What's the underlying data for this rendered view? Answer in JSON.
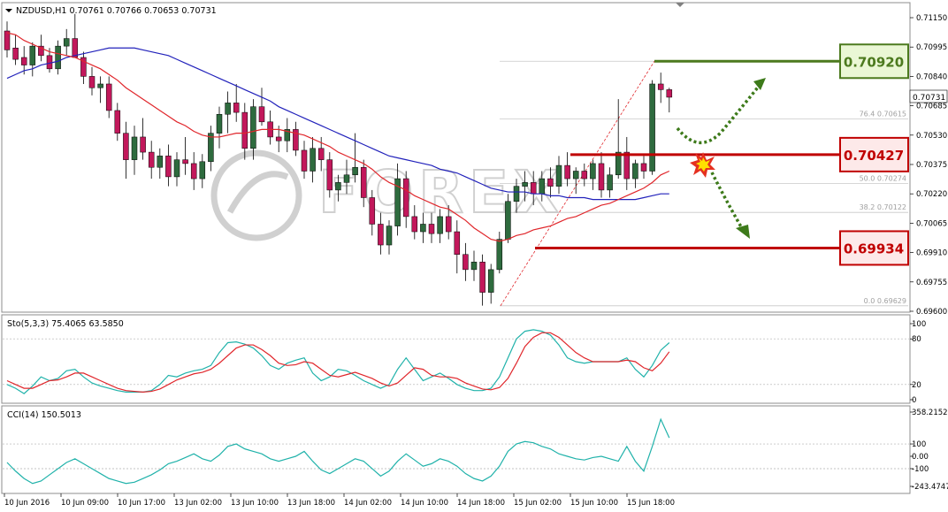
{
  "header": {
    "symbol_line": "NZDUSD,H1  0.70761 0.70766 0.70653 0.70731",
    "stoch_label": "Sto(5,3,3) 75.4065 63.5850",
    "cci_label": "CCI(14) 150.5013"
  },
  "watermark": "FOREX",
  "price_axis": {
    "ticks": [
      "0.71150",
      "0.70995",
      "0.70840",
      "0.70685",
      "0.70530",
      "0.70375",
      "0.70220",
      "0.70065",
      "0.69910",
      "0.69755",
      "0.69600"
    ],
    "current": "0.70731"
  },
  "stoch_axis": {
    "ticks": [
      "100",
      "80",
      "20",
      "0"
    ]
  },
  "cci_axis": {
    "ticks": [
      "358.2152",
      "100",
      "0.00",
      "-100",
      "-243.4747"
    ]
  },
  "time_axis": {
    "labels": [
      "10 Jun 2016",
      "10 Jun 09:00",
      "10 Jun 17:00",
      "13 Jun 02:00",
      "13 Jun 10:00",
      "13 Jun 18:00",
      "14 Jun 02:00",
      "14 Jun 10:00",
      "14 Jun 18:00",
      "15 Jun 02:00",
      "15 Jun 10:00",
      "15 Jun 18:00"
    ]
  },
  "fibonacci": {
    "levels": [
      {
        "label": "76.4  0.70615",
        "value": 0.70615
      },
      {
        "label": "50.0  0.70274",
        "value": 0.70274
      },
      {
        "label": "38.2  0.70122",
        "value": 0.70122
      },
      {
        "label": "0.0  0.69629",
        "value": 0.69629
      }
    ],
    "top_value": 0.7092
  },
  "levels": [
    {
      "label": "0.70920",
      "value": 0.7092,
      "color": "#4c7a1e",
      "bg": "#eaf7d5",
      "name": "resistance-level"
    },
    {
      "label": "0.70427",
      "value": 0.70427,
      "color": "#c00000",
      "bg": "#fde9e9",
      "name": "pivot-level"
    },
    {
      "label": "0.69934",
      "value": 0.69934,
      "color": "#c00000",
      "bg": "#fde9e9",
      "name": "support-level"
    }
  ],
  "colors": {
    "bull": "#2e6b3e",
    "bear": "#c2185b",
    "ma_fast": "#e0262b",
    "ma_slow": "#2222bb",
    "stoch_main": "#20b2aa",
    "stoch_signal": "#e0262b",
    "cci": "#20b2aa",
    "arrow": "#3d7a1a"
  },
  "chart_data": {
    "type": "candlestick",
    "symbol": "NZDUSD",
    "timeframe": "H1",
    "ylim": [
      0.696,
      0.712
    ],
    "candles": [
      [
        0.7108,
        0.7113,
        0.7094,
        0.7098
      ],
      [
        0.7099,
        0.7106,
        0.709,
        0.7093
      ],
      [
        0.7094,
        0.71,
        0.7085,
        0.709
      ],
      [
        0.709,
        0.7102,
        0.7084,
        0.71
      ],
      [
        0.71,
        0.7106,
        0.7092,
        0.7095
      ],
      [
        0.7095,
        0.7099,
        0.7086,
        0.7088
      ],
      [
        0.7088,
        0.7103,
        0.7085,
        0.71
      ],
      [
        0.71,
        0.7109,
        0.7095,
        0.7104
      ],
      [
        0.7104,
        0.7117,
        0.7098,
        0.7094
      ],
      [
        0.7094,
        0.7097,
        0.708,
        0.7084
      ],
      [
        0.7084,
        0.7089,
        0.7074,
        0.7078
      ],
      [
        0.7078,
        0.7084,
        0.707,
        0.708
      ],
      [
        0.708,
        0.7084,
        0.7062,
        0.7066
      ],
      [
        0.7066,
        0.707,
        0.705,
        0.7054
      ],
      [
        0.7054,
        0.706,
        0.703,
        0.704
      ],
      [
        0.704,
        0.7058,
        0.7032,
        0.7052
      ],
      [
        0.7052,
        0.7062,
        0.704,
        0.7044
      ],
      [
        0.7044,
        0.705,
        0.703,
        0.7036
      ],
      [
        0.7036,
        0.7046,
        0.703,
        0.7042
      ],
      [
        0.7042,
        0.7048,
        0.7026,
        0.7031
      ],
      [
        0.7031,
        0.7044,
        0.7026,
        0.704
      ],
      [
        0.704,
        0.7052,
        0.7032,
        0.7038
      ],
      [
        0.7038,
        0.7044,
        0.7024,
        0.703
      ],
      [
        0.703,
        0.7043,
        0.7025,
        0.7039
      ],
      [
        0.7039,
        0.7058,
        0.7034,
        0.7054
      ],
      [
        0.7054,
        0.7068,
        0.7046,
        0.7064
      ],
      [
        0.7064,
        0.7076,
        0.7054,
        0.707
      ],
      [
        0.707,
        0.708,
        0.706,
        0.7065
      ],
      [
        0.7065,
        0.707,
        0.704,
        0.7046
      ],
      [
        0.7046,
        0.7072,
        0.704,
        0.7068
      ],
      [
        0.7068,
        0.7078,
        0.7058,
        0.706
      ],
      [
        0.706,
        0.7066,
        0.7048,
        0.7052
      ],
      [
        0.7052,
        0.7058,
        0.7044,
        0.705
      ],
      [
        0.705,
        0.7062,
        0.7044,
        0.7056
      ],
      [
        0.7056,
        0.706,
        0.7042,
        0.7045
      ],
      [
        0.7045,
        0.705,
        0.703,
        0.7034
      ],
      [
        0.7034,
        0.7052,
        0.7028,
        0.7046
      ],
      [
        0.7046,
        0.7052,
        0.7034,
        0.704
      ],
      [
        0.704,
        0.7044,
        0.702,
        0.7024
      ],
      [
        0.7024,
        0.7032,
        0.7018,
        0.7028
      ],
      [
        0.7028,
        0.704,
        0.7022,
        0.7032
      ],
      [
        0.7032,
        0.7054,
        0.7028,
        0.7036
      ],
      [
        0.7036,
        0.704,
        0.7015,
        0.702
      ],
      [
        0.702,
        0.7024,
        0.7,
        0.7006
      ],
      [
        0.7006,
        0.7012,
        0.699,
        0.6995
      ],
      [
        0.6995,
        0.7008,
        0.699,
        0.7005
      ],
      [
        0.7005,
        0.7038,
        0.7,
        0.703
      ],
      [
        0.703,
        0.7034,
        0.7004,
        0.701
      ],
      [
        0.701,
        0.7016,
        0.6998,
        0.7002
      ],
      [
        0.7002,
        0.7012,
        0.6996,
        0.7006
      ],
      [
        0.7006,
        0.7012,
        0.6996,
        0.7001
      ],
      [
        0.7001,
        0.7014,
        0.6996,
        0.701
      ],
      [
        0.701,
        0.7016,
        0.6998,
        0.7002
      ],
      [
        0.7002,
        0.7008,
        0.698,
        0.699
      ],
      [
        0.699,
        0.6996,
        0.6976,
        0.6982
      ],
      [
        0.6982,
        0.6992,
        0.6976,
        0.6986
      ],
      [
        0.6986,
        0.699,
        0.6963,
        0.697
      ],
      [
        0.697,
        0.6985,
        0.6964,
        0.6982
      ],
      [
        0.6982,
        0.7002,
        0.698,
        0.6998
      ],
      [
        0.6998,
        0.7022,
        0.6996,
        0.7018
      ],
      [
        0.7018,
        0.703,
        0.7012,
        0.7026
      ],
      [
        0.7026,
        0.7034,
        0.7018,
        0.7028
      ],
      [
        0.7028,
        0.7034,
        0.7016,
        0.7022
      ],
      [
        0.7022,
        0.7034,
        0.7018,
        0.703
      ],
      [
        0.703,
        0.7036,
        0.702,
        0.7026
      ],
      [
        0.7026,
        0.7042,
        0.7022,
        0.7037
      ],
      [
        0.7037,
        0.7044,
        0.7026,
        0.703
      ],
      [
        0.703,
        0.7036,
        0.7022,
        0.7034
      ],
      [
        0.7034,
        0.7038,
        0.7026,
        0.703
      ],
      [
        0.703,
        0.704,
        0.7024,
        0.7038
      ],
      [
        0.7038,
        0.7044,
        0.702,
        0.7024
      ],
      [
        0.7024,
        0.7036,
        0.702,
        0.7032
      ],
      [
        0.7032,
        0.7072,
        0.703,
        0.7044
      ],
      [
        0.7044,
        0.7052,
        0.7024,
        0.703
      ],
      [
        0.703,
        0.704,
        0.7025,
        0.7038
      ],
      [
        0.7038,
        0.7042,
        0.703,
        0.7034
      ],
      [
        0.7034,
        0.7082,
        0.7032,
        0.708
      ],
      [
        0.708,
        0.7086,
        0.707,
        0.7077
      ],
      [
        0.7077,
        0.7078,
        0.7065,
        0.7073
      ]
    ],
    "ma_fast": [
      0.7107,
      0.7106,
      0.7103,
      0.7101,
      0.7099,
      0.7097,
      0.7096,
      0.7095,
      0.7094,
      0.7092,
      0.709,
      0.7088,
      0.7085,
      0.7082,
      0.7078,
      0.7075,
      0.7072,
      0.7069,
      0.7066,
      0.7063,
      0.706,
      0.7058,
      0.7055,
      0.7053,
      0.7052,
      0.7052,
      0.7053,
      0.7054,
      0.7054,
      0.7055,
      0.7056,
      0.7056,
      0.7056,
      0.7055,
      0.7054,
      0.7053,
      0.7051,
      0.7049,
      0.7047,
      0.7044,
      0.7042,
      0.704,
      0.7038,
      0.7035,
      0.7031,
      0.7028,
      0.7026,
      0.7024,
      0.7021,
      0.7019,
      0.7017,
      0.7015,
      0.7014,
      0.7011,
      0.7008,
      0.7004,
      0.7001,
      0.6998,
      0.6997,
      0.6998,
      0.7,
      0.7001,
      0.7003,
      0.7004,
      0.7005,
      0.7007,
      0.7009,
      0.701,
      0.7012,
      0.7014,
      0.7016,
      0.7017,
      0.7019,
      0.7021,
      0.7023,
      0.7025,
      0.7028,
      0.7032,
      0.7034
    ],
    "ma_slow": [
      0.7083,
      0.7085,
      0.7087,
      0.7088,
      0.709,
      0.7091,
      0.7092,
      0.7094,
      0.7095,
      0.7096,
      0.7097,
      0.7098,
      0.7099,
      0.7099,
      0.7099,
      0.7099,
      0.7098,
      0.7097,
      0.7096,
      0.7095,
      0.7093,
      0.7091,
      0.7089,
      0.7087,
      0.7085,
      0.7083,
      0.7081,
      0.7079,
      0.7077,
      0.7075,
      0.7073,
      0.7071,
      0.7068,
      0.7066,
      0.7064,
      0.7062,
      0.706,
      0.7058,
      0.7056,
      0.7054,
      0.7052,
      0.705,
      0.7048,
      0.7046,
      0.7044,
      0.7042,
      0.7041,
      0.704,
      0.7039,
      0.7038,
      0.7037,
      0.7035,
      0.7034,
      0.7033,
      0.7031,
      0.7029,
      0.7027,
      0.7025,
      0.7024,
      0.7023,
      0.7023,
      0.7023,
      0.7022,
      0.7022,
      0.7021,
      0.7021,
      0.702,
      0.702,
      0.702,
      0.7019,
      0.7019,
      0.7019,
      0.7019,
      0.7019,
      0.7019,
      0.702,
      0.7021,
      0.7022,
      0.7022
    ],
    "stoch_main": [
      20,
      15,
      8,
      18,
      30,
      25,
      28,
      38,
      40,
      30,
      22,
      18,
      15,
      12,
      10,
      10,
      10,
      12,
      20,
      32,
      30,
      35,
      38,
      40,
      45,
      62,
      75,
      76,
      73,
      68,
      58,
      45,
      40,
      48,
      52,
      55,
      35,
      25,
      30,
      40,
      38,
      32,
      25,
      20,
      15,
      20,
      40,
      55,
      40,
      25,
      30,
      35,
      28,
      20,
      15,
      12,
      12,
      15,
      30,
      55,
      80,
      90,
      92,
      90,
      85,
      72,
      55,
      50,
      48,
      50,
      50,
      50,
      50,
      55,
      40,
      30,
      45,
      65,
      75
    ],
    "stoch_signal": [
      25,
      20,
      15,
      15,
      20,
      25,
      26,
      30,
      35,
      35,
      30,
      25,
      20,
      15,
      12,
      11,
      10,
      11,
      14,
      20,
      26,
      30,
      34,
      36,
      40,
      48,
      58,
      68,
      72,
      72,
      66,
      58,
      48,
      45,
      46,
      50,
      48,
      40,
      32,
      30,
      33,
      36,
      32,
      28,
      22,
      18,
      22,
      32,
      42,
      40,
      32,
      30,
      30,
      28,
      22,
      18,
      14,
      13,
      16,
      28,
      48,
      70,
      82,
      88,
      88,
      82,
      72,
      62,
      55,
      50,
      50,
      50,
      50,
      52,
      50,
      42,
      38,
      48,
      63
    ],
    "cci": [
      -50,
      -120,
      -180,
      -220,
      -200,
      -150,
      -100,
      -50,
      -20,
      -60,
      -100,
      -140,
      -180,
      -200,
      -220,
      -210,
      -180,
      -150,
      -110,
      -60,
      -40,
      -10,
      20,
      -20,
      -40,
      10,
      80,
      100,
      60,
      40,
      20,
      -20,
      -40,
      -20,
      0,
      40,
      -40,
      -110,
      -140,
      -100,
      -60,
      -20,
      -40,
      -100,
      -160,
      -120,
      -40,
      20,
      -30,
      -80,
      -60,
      -20,
      -40,
      -80,
      -140,
      -180,
      -200,
      -160,
      -80,
      40,
      100,
      120,
      110,
      80,
      60,
      20,
      0,
      -20,
      -30,
      -10,
      0,
      -20,
      -40,
      80,
      -40,
      -120,
      80,
      300,
      150
    ]
  }
}
